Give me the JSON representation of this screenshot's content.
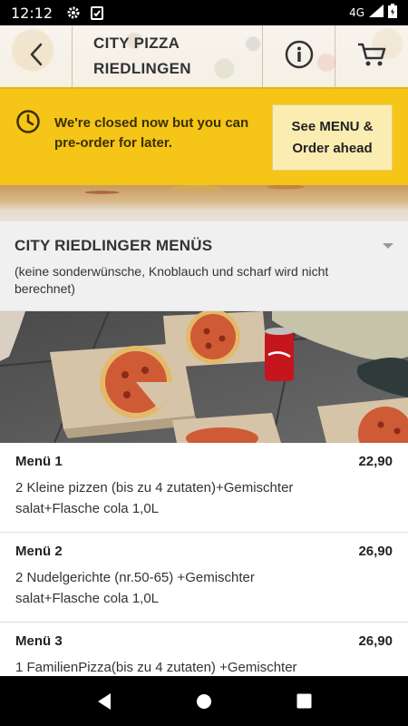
{
  "status_bar": {
    "time": "12:12",
    "network": "4G",
    "icons": [
      "gear-icon",
      "clipboard-check-icon",
      "signal-icon",
      "battery-icon"
    ]
  },
  "header": {
    "title": "CITY PIZZA RIEDLINGEN",
    "icons": [
      "back-arrow-icon",
      "info-icon",
      "cart-icon"
    ]
  },
  "banner": {
    "message": "We're closed now but you can pre-order for later.",
    "button_label": "See MENU & Order ahead",
    "icon": "clock-icon",
    "color": "#f5c518"
  },
  "category": {
    "title": "CITY RIEDLINGER MENÜS",
    "description": "(keine sonderwünsche, Knoblauch und scharf wird nicht berechnet)",
    "toggle_icon": "dropdown-triangle-icon"
  },
  "menu_items": [
    {
      "name": "Menü 1",
      "price": "22,90",
      "description": "2 Kleine pizzen (bis zu 4 zutaten)+Gemischter salat+Flasche cola 1,0L"
    },
    {
      "name": "Menü 2",
      "price": "26,90",
      "description": "2 Nudelgerichte (nr.50-65) +Gemischter salat+Flasche cola 1,0L"
    },
    {
      "name": "Menü 3",
      "price": "26,90",
      "description": "1 FamilienPizza(bis zu 4 zutaten) +Gemischter"
    }
  ],
  "nav_bar": {
    "icons": [
      "back-triangle-icon",
      "home-circle-icon",
      "recents-square-icon"
    ]
  }
}
